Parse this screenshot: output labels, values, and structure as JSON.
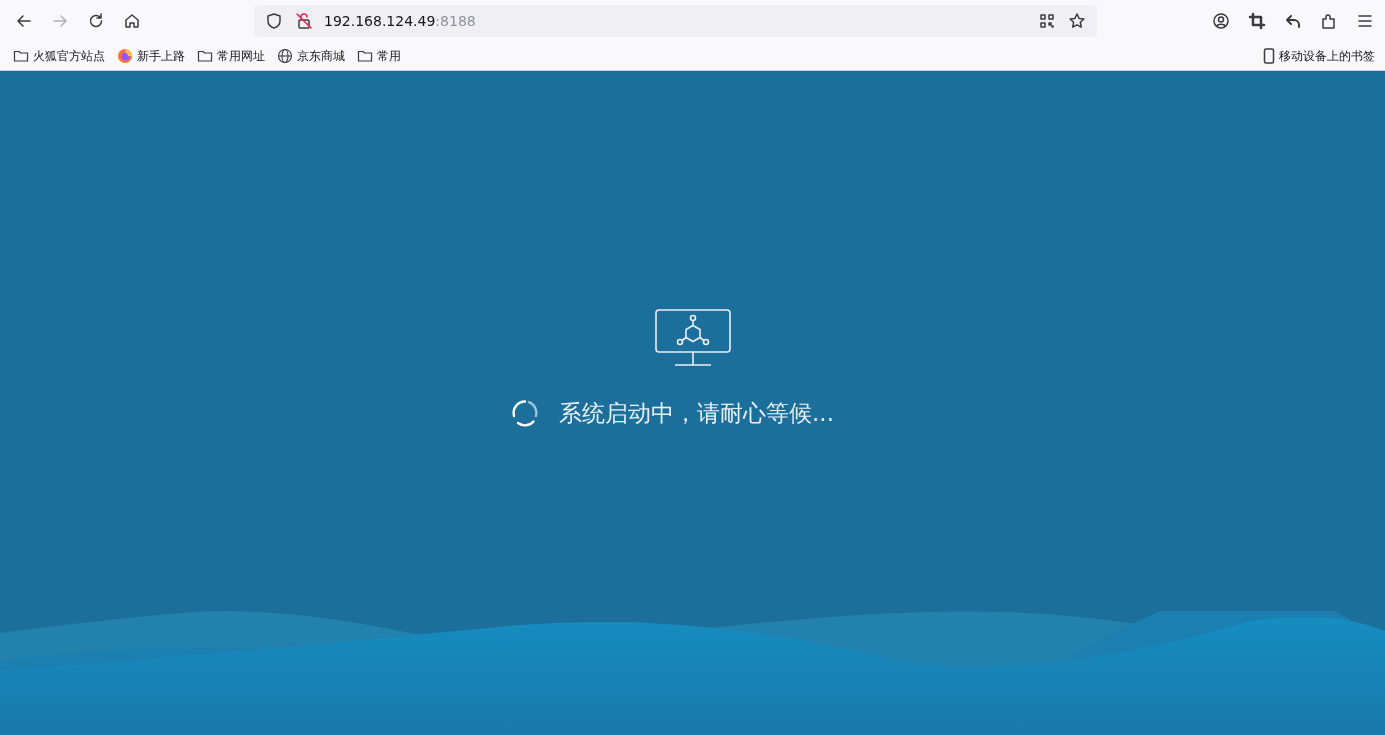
{
  "browser": {
    "address": {
      "host": "192.168.124.49",
      "port": ":8188"
    },
    "bookmarks": [
      {
        "label": "火狐官方站点",
        "kind": "folder"
      },
      {
        "label": "新手上路",
        "kind": "firefox"
      },
      {
        "label": "常用网址",
        "kind": "folder"
      },
      {
        "label": "京东商城",
        "kind": "globe"
      },
      {
        "label": "常用",
        "kind": "folder"
      }
    ],
    "mobile_bookmarks": "移动设备上的书签"
  },
  "page": {
    "message": "系统启动中，请耐心等候..."
  }
}
